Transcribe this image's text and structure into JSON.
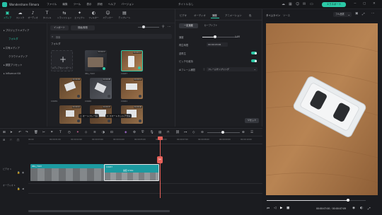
{
  "app": {
    "name": "Wondershare Filmora",
    "menu": [
      "ファイル",
      "編集",
      "ツール",
      "表示",
      "詳細",
      "ヘルプ",
      "バージョン"
    ],
    "window_title": "タイトルなし",
    "export_label": "エクスポート"
  },
  "toolbar": {
    "items": [
      {
        "label": "メディア",
        "icon": "media-icon",
        "glyph": "▣"
      },
      {
        "label": "ストック",
        "icon": "stock-icon",
        "glyph": "☁"
      },
      {
        "label": "オーディオ",
        "icon": "audio-icon",
        "glyph": "♪"
      },
      {
        "label": "タイトル",
        "icon": "title-icon",
        "glyph": "T"
      },
      {
        "label": "トランジション",
        "icon": "transition-icon",
        "glyph": "⇆"
      },
      {
        "label": "エフェクト",
        "icon": "effect-icon",
        "glyph": "✦"
      },
      {
        "label": "フィルター",
        "icon": "filter-icon",
        "glyph": "◐"
      },
      {
        "label": "ステッカー",
        "icon": "sticker-icon",
        "glyph": "☺"
      },
      {
        "label": "テンプレート",
        "icon": "template-icon",
        "glyph": "▤"
      }
    ]
  },
  "sidebar": {
    "items": [
      {
        "label": "プロジェクトメディア",
        "active": false
      },
      {
        "label": "フォルダ",
        "active": true
      },
      {
        "label": "共有メディア",
        "active": false
      },
      {
        "label": "クラウドメディア",
        "active": false
      },
      {
        "label": "調整プリセット",
        "active": false
      },
      {
        "label": "Influence Kit",
        "active": false
      }
    ]
  },
  "media": {
    "import_label": "インポート",
    "record_label": "録画/録音",
    "search_placeholder": "検索",
    "folder_label": "フォルダ",
    "import_tile_label": "メディアをインポート",
    "items": [
      {
        "name": "IMG_7943",
        "badge": "00:00:15",
        "state": "check"
      },
      {
        "name": "C0937",
        "badge": "00:00:11",
        "state": "check"
      },
      {
        "name": "C0939",
        "badge": "00:00:09",
        "state": "dl"
      },
      {
        "name": "C0940",
        "badge": "00:00:08",
        "state": "dl"
      },
      {
        "name": "C0941",
        "badge": "00:00:12",
        "state": "dl"
      },
      {
        "name": "C0944",
        "badge": "00:00:10",
        "state": "dl"
      },
      {
        "name": "C0945",
        "badge": "00:00:07",
        "state": "dl"
      },
      {
        "name": "C0946",
        "badge": "00:00:06",
        "state": "dl"
      },
      {
        "name": "C0947",
        "badge": "00:00:09",
        "state": "dl"
      }
    ],
    "auto_frame_label": "オートフレーム",
    "smart_cutout_label": "スマートカットアウト"
  },
  "props": {
    "tabs": [
      "ビデオ",
      "オーディオ",
      "速度",
      "アニメーション",
      "色"
    ],
    "active_tab": "速度",
    "subtabs": [
      "一定速度",
      "カーブシフト"
    ],
    "speed_label": "速度",
    "speed_value": "1.00",
    "duration_label": "再生時間",
    "duration_value": "00:00:03:06",
    "reverse_label": "逆再生",
    "ripple_label": "ピッチを維持",
    "ai_label": "AIフレーム補間",
    "ai_value": "フレームサンプリング",
    "reset_label": "リセット",
    "speed_fill": 0.35
  },
  "preview": {
    "tabs": [
      "タイムライン",
      "ソース"
    ],
    "quality_label": "フル品質",
    "current_time": "00:00:07:00",
    "total_time": "00:00:07:09",
    "progress": 0.82
  },
  "timeline": {
    "ruler": [
      "00:00",
      "00:00:01:00",
      "00:00:02:00",
      "00:00:03:00",
      "00:00:04:00",
      "00:00:05:00",
      "00:00:06:00",
      "00:00:07:00",
      "00:00:08:00",
      "00:00:09:00",
      "00:00:10:00"
    ],
    "video_track_label": "ビデオ 1",
    "audio_track_label": "オーディオ 1",
    "clips": [
      {
        "name": "IMG_7943",
        "speed": ""
      },
      {
        "name": "C0937",
        "speed": "速度 0.50x"
      }
    ]
  },
  "colors": {
    "accent": "#2bc9a6",
    "playhead": "#e8615a",
    "clip": "#1fa3a8"
  }
}
